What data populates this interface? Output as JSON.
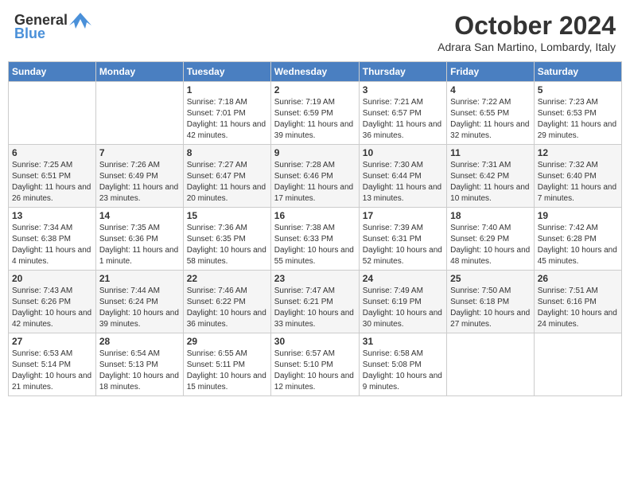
{
  "logo": {
    "general": "General",
    "blue": "Blue"
  },
  "title": "October 2024",
  "location": "Adrara San Martino, Lombardy, Italy",
  "weekdays": [
    "Sunday",
    "Monday",
    "Tuesday",
    "Wednesday",
    "Thursday",
    "Friday",
    "Saturday"
  ],
  "weeks": [
    [
      {
        "day": "",
        "info": ""
      },
      {
        "day": "",
        "info": ""
      },
      {
        "day": "1",
        "info": "Sunrise: 7:18 AM\nSunset: 7:01 PM\nDaylight: 11 hours and 42 minutes."
      },
      {
        "day": "2",
        "info": "Sunrise: 7:19 AM\nSunset: 6:59 PM\nDaylight: 11 hours and 39 minutes."
      },
      {
        "day": "3",
        "info": "Sunrise: 7:21 AM\nSunset: 6:57 PM\nDaylight: 11 hours and 36 minutes."
      },
      {
        "day": "4",
        "info": "Sunrise: 7:22 AM\nSunset: 6:55 PM\nDaylight: 11 hours and 32 minutes."
      },
      {
        "day": "5",
        "info": "Sunrise: 7:23 AM\nSunset: 6:53 PM\nDaylight: 11 hours and 29 minutes."
      }
    ],
    [
      {
        "day": "6",
        "info": "Sunrise: 7:25 AM\nSunset: 6:51 PM\nDaylight: 11 hours and 26 minutes."
      },
      {
        "day": "7",
        "info": "Sunrise: 7:26 AM\nSunset: 6:49 PM\nDaylight: 11 hours and 23 minutes."
      },
      {
        "day": "8",
        "info": "Sunrise: 7:27 AM\nSunset: 6:47 PM\nDaylight: 11 hours and 20 minutes."
      },
      {
        "day": "9",
        "info": "Sunrise: 7:28 AM\nSunset: 6:46 PM\nDaylight: 11 hours and 17 minutes."
      },
      {
        "day": "10",
        "info": "Sunrise: 7:30 AM\nSunset: 6:44 PM\nDaylight: 11 hours and 13 minutes."
      },
      {
        "day": "11",
        "info": "Sunrise: 7:31 AM\nSunset: 6:42 PM\nDaylight: 11 hours and 10 minutes."
      },
      {
        "day": "12",
        "info": "Sunrise: 7:32 AM\nSunset: 6:40 PM\nDaylight: 11 hours and 7 minutes."
      }
    ],
    [
      {
        "day": "13",
        "info": "Sunrise: 7:34 AM\nSunset: 6:38 PM\nDaylight: 11 hours and 4 minutes."
      },
      {
        "day": "14",
        "info": "Sunrise: 7:35 AM\nSunset: 6:36 PM\nDaylight: 11 hours and 1 minute."
      },
      {
        "day": "15",
        "info": "Sunrise: 7:36 AM\nSunset: 6:35 PM\nDaylight: 10 hours and 58 minutes."
      },
      {
        "day": "16",
        "info": "Sunrise: 7:38 AM\nSunset: 6:33 PM\nDaylight: 10 hours and 55 minutes."
      },
      {
        "day": "17",
        "info": "Sunrise: 7:39 AM\nSunset: 6:31 PM\nDaylight: 10 hours and 52 minutes."
      },
      {
        "day": "18",
        "info": "Sunrise: 7:40 AM\nSunset: 6:29 PM\nDaylight: 10 hours and 48 minutes."
      },
      {
        "day": "19",
        "info": "Sunrise: 7:42 AM\nSunset: 6:28 PM\nDaylight: 10 hours and 45 minutes."
      }
    ],
    [
      {
        "day": "20",
        "info": "Sunrise: 7:43 AM\nSunset: 6:26 PM\nDaylight: 10 hours and 42 minutes."
      },
      {
        "day": "21",
        "info": "Sunrise: 7:44 AM\nSunset: 6:24 PM\nDaylight: 10 hours and 39 minutes."
      },
      {
        "day": "22",
        "info": "Sunrise: 7:46 AM\nSunset: 6:22 PM\nDaylight: 10 hours and 36 minutes."
      },
      {
        "day": "23",
        "info": "Sunrise: 7:47 AM\nSunset: 6:21 PM\nDaylight: 10 hours and 33 minutes."
      },
      {
        "day": "24",
        "info": "Sunrise: 7:49 AM\nSunset: 6:19 PM\nDaylight: 10 hours and 30 minutes."
      },
      {
        "day": "25",
        "info": "Sunrise: 7:50 AM\nSunset: 6:18 PM\nDaylight: 10 hours and 27 minutes."
      },
      {
        "day": "26",
        "info": "Sunrise: 7:51 AM\nSunset: 6:16 PM\nDaylight: 10 hours and 24 minutes."
      }
    ],
    [
      {
        "day": "27",
        "info": "Sunrise: 6:53 AM\nSunset: 5:14 PM\nDaylight: 10 hours and 21 minutes."
      },
      {
        "day": "28",
        "info": "Sunrise: 6:54 AM\nSunset: 5:13 PM\nDaylight: 10 hours and 18 minutes."
      },
      {
        "day": "29",
        "info": "Sunrise: 6:55 AM\nSunset: 5:11 PM\nDaylight: 10 hours and 15 minutes."
      },
      {
        "day": "30",
        "info": "Sunrise: 6:57 AM\nSunset: 5:10 PM\nDaylight: 10 hours and 12 minutes."
      },
      {
        "day": "31",
        "info": "Sunrise: 6:58 AM\nSunset: 5:08 PM\nDaylight: 10 hours and 9 minutes."
      },
      {
        "day": "",
        "info": ""
      },
      {
        "day": "",
        "info": ""
      }
    ]
  ]
}
